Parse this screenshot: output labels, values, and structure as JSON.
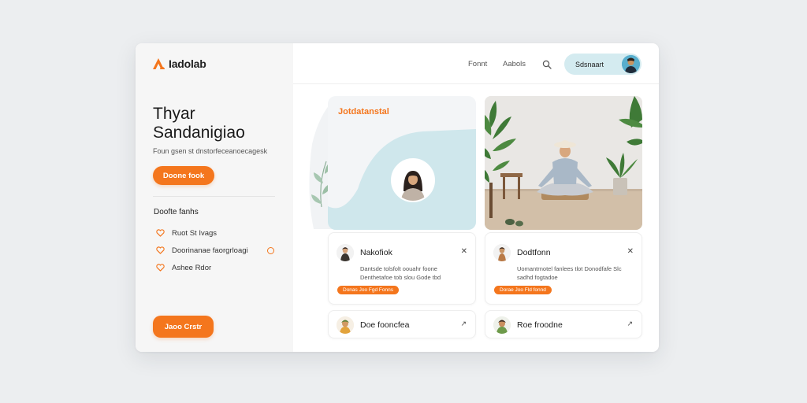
{
  "app": {
    "brand_name": "Iadolab"
  },
  "nav": {
    "links": [
      "Fonnt",
      "Aabols"
    ],
    "account_label": "Sdsnaart"
  },
  "hero": {
    "title_line1": "Thyar",
    "title_line2": "Sandanigiao",
    "subtitle": "Foun gsen st dnstorfeceanoecagesk",
    "primary_button": "Doone fook"
  },
  "features": {
    "section_title": "Doofte fanhs",
    "items": [
      "Ruot St Ivags",
      "Doorinanae faorgrloagi",
      "Ashee Rdor"
    ],
    "cta_button": "Jaoo Crstr"
  },
  "feature_card": {
    "title": "Jotdatanstal"
  },
  "profile_cards": [
    {
      "name": "Nakofiok",
      "description": "Dantsde tolsfolt oouahr foone Denthetafoe tob slou Gode tbd",
      "tag": "Donas Joo Fgd Fonns"
    },
    {
      "name": "Dodtfonn",
      "description": "Uomantrnotel fanlees tlot Donodfafe Slc sadhd fogtadoe",
      "tag": "Dorae Joo Fld fonnd"
    }
  ],
  "row_cards": [
    {
      "name": "Doe fooncfea"
    },
    {
      "name": "Roe froodne"
    }
  ],
  "colors": {
    "accent": "#f4761d",
    "account_pill": "#d4ebf0",
    "wave": "#cfe7ec"
  },
  "icons": {
    "brand": "brand-logo-icon",
    "search": "search-icon",
    "feature": "heart-icon",
    "close": "close-icon",
    "chevron": "chevron-right-icon"
  }
}
